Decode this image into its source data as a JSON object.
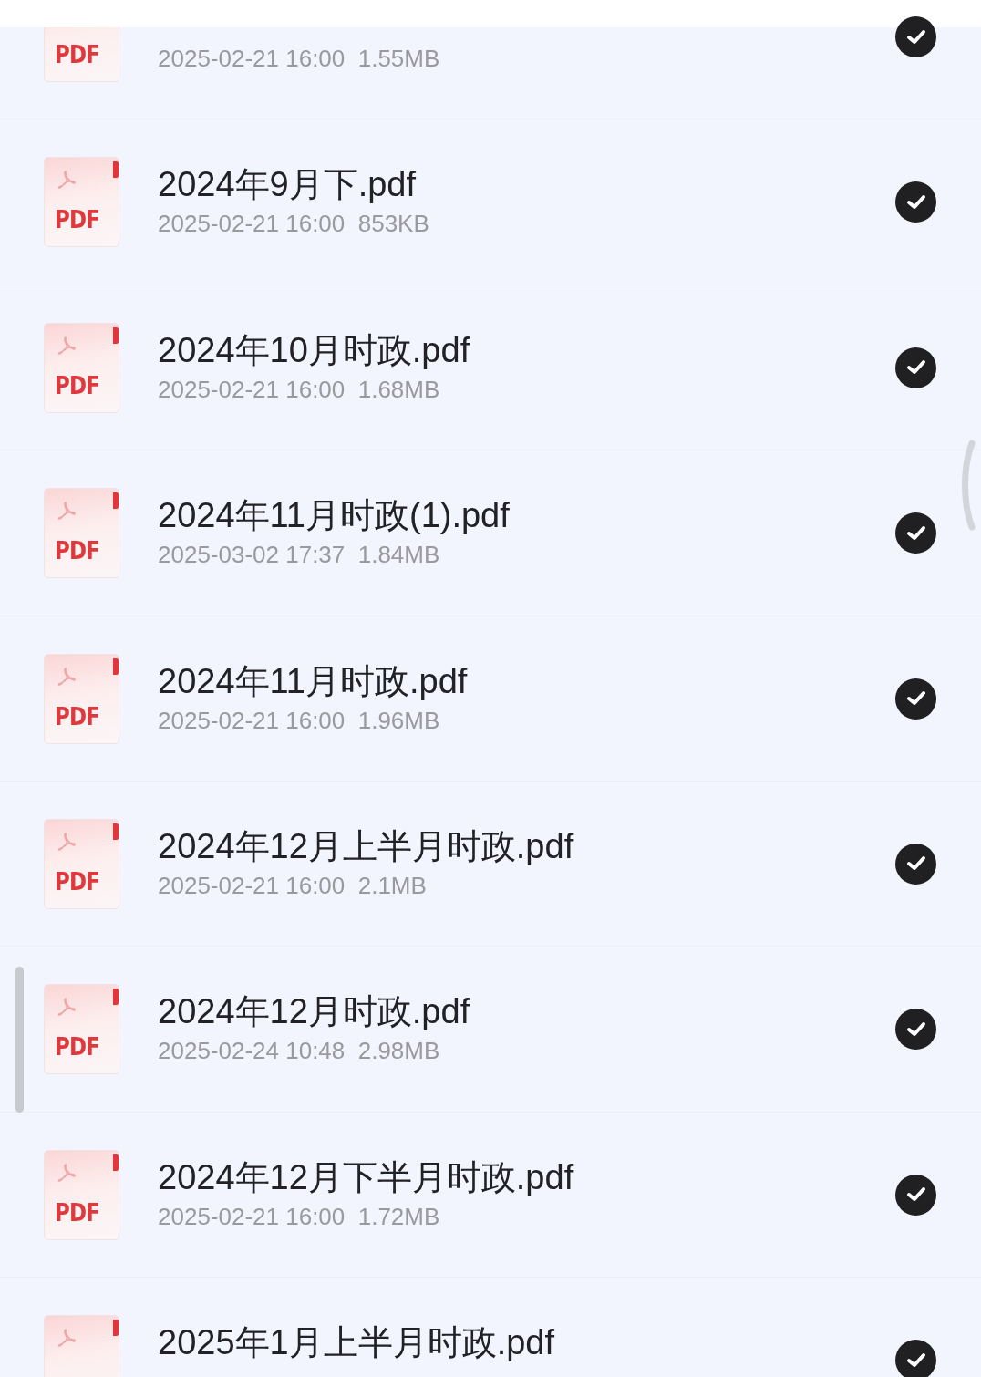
{
  "files": [
    {
      "meta": "2025-02-21 16:00  1.55MB",
      "type_label": "PDF",
      "checked": true
    },
    {
      "name": "2024年9月下.pdf",
      "meta": "2025-02-21 16:00  853KB",
      "type_label": "PDF",
      "checked": true
    },
    {
      "name": "2024年10月时政.pdf",
      "meta": "2025-02-21 16:00  1.68MB",
      "type_label": "PDF",
      "checked": true
    },
    {
      "name": "2024年11月时政(1).pdf",
      "meta": "2025-03-02 17:37  1.84MB",
      "type_label": "PDF",
      "checked": true
    },
    {
      "name": "2024年11月时政.pdf",
      "meta": "2025-02-21 16:00  1.96MB",
      "type_label": "PDF",
      "checked": true
    },
    {
      "name": "2024年12月上半月时政.pdf",
      "meta": "2025-02-21 16:00  2.1MB",
      "type_label": "PDF",
      "checked": true
    },
    {
      "name": "2024年12月时政.pdf",
      "meta": "2025-02-24 10:48  2.98MB",
      "type_label": "PDF",
      "checked": true
    },
    {
      "name": "2024年12月下半月时政.pdf",
      "meta": "2025-02-21 16:00  1.72MB",
      "type_label": "PDF",
      "checked": true
    },
    {
      "name": "2025年1月上半月时政.pdf",
      "checked": true
    }
  ]
}
